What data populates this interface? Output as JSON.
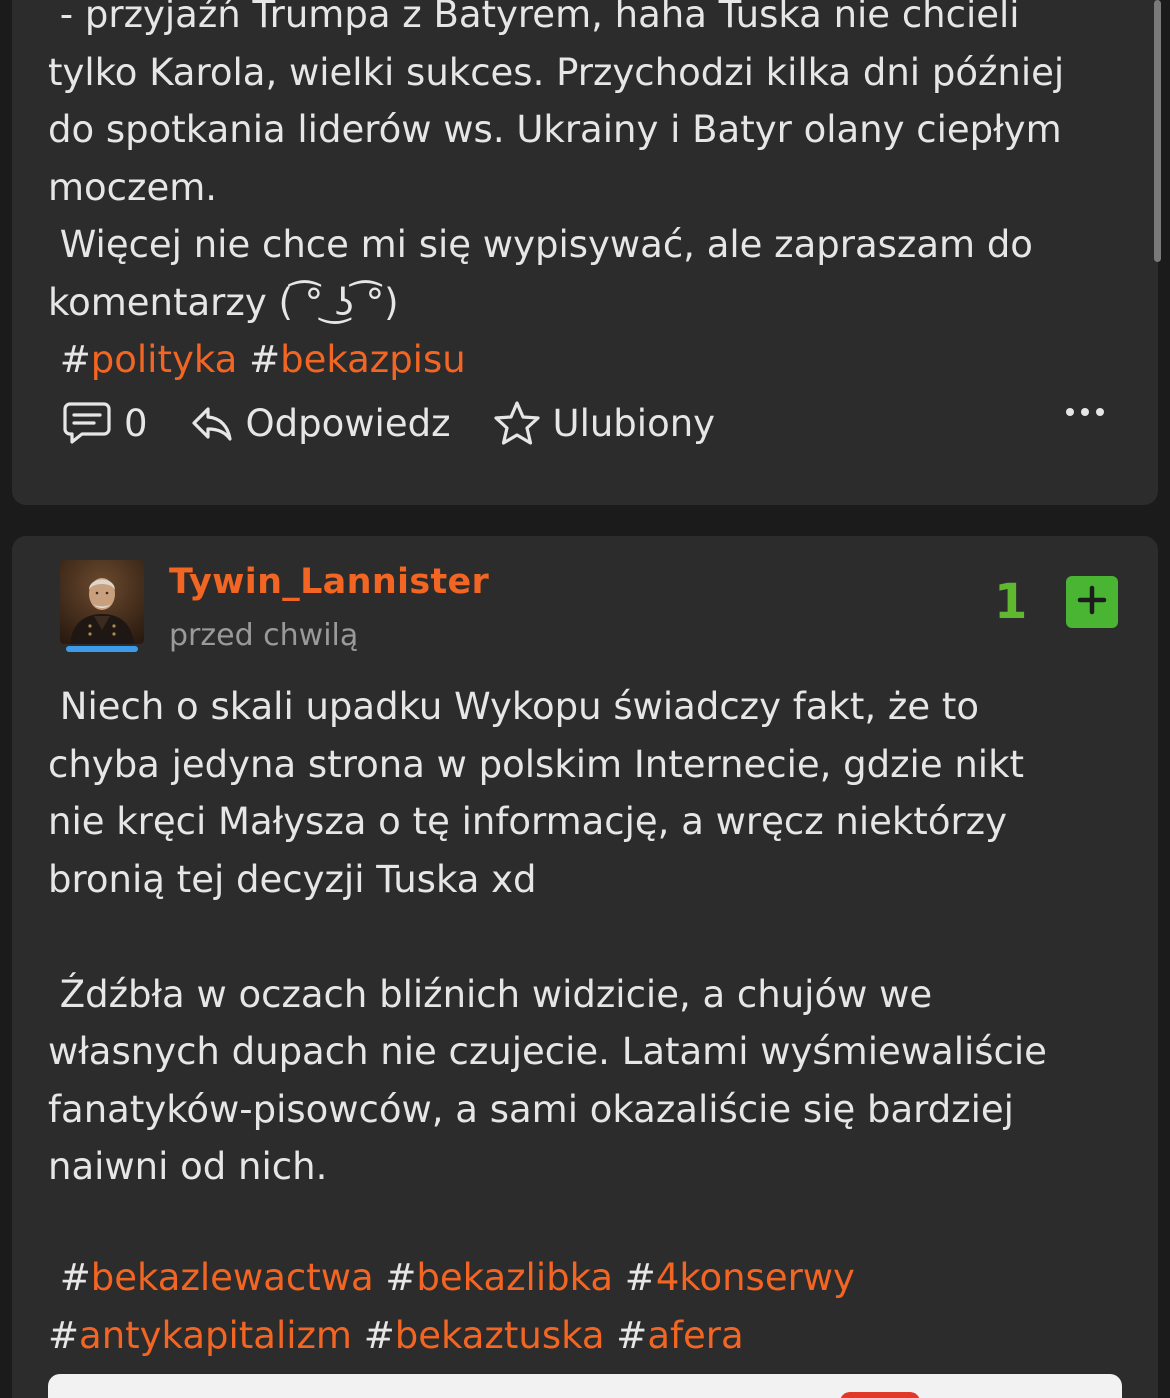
{
  "top_post": {
    "body": " - przyjaźń Trumpa z Batyrem, haha Tuska nie chcieli\ntylko Karola, wielki sukces. Przychodzi kilka dni później\ndo spotkania liderów ws. Ukrainy i Batyr olany ciepłym\nmoczem.\n Więcej nie chce mi się wypisywać, ale zapraszam do\nkomentarzy ( ͡° ͜ʖ ͡°)",
    "tags": [
      "polityka",
      "bekazpisu"
    ],
    "actions": {
      "comment_count": "0",
      "reply_label": "Odpowiedz",
      "favorite_label": "Ulubiony"
    }
  },
  "entry": {
    "username": "Tywin_Lannister",
    "timestamp": "przed chwilą",
    "votes": "1",
    "plus_label": "+",
    "body": " Niech o skali upadku Wykopu świadczy fakt, że to\nchyba jedyna strona w polskim Internecie, gdzie nikt\nnie kręci Małysza o tę informację, a wręcz niektórzy\nbronią tej decyzji Tuska xd\n\n Źdźbła w oczach bliźnich widzicie, a chujów we\nwłasnych dupach nie czujecie. Latami wyśmiewaliście\nfanatyków-pisowców, a sami okazaliście się bardziej\nnaiwni od nich.",
    "tags_line1": [
      "bekazlewactwa",
      "bekazlibka",
      "4konserwy"
    ],
    "tags_line2": [
      "antykapitalizm",
      "bekaztuska",
      "afera"
    ]
  },
  "colors": {
    "background": "#1b1b1b",
    "card": "#2c2c2c",
    "accent_orange": "#f26522",
    "vote_green": "#5fb830",
    "plus_green": "#4ab533",
    "avatar_bar_blue": "#3d9be9"
  },
  "icons": {
    "comment": "comment-icon",
    "reply": "reply-icon",
    "favorite": "star-icon",
    "more": "more-icon",
    "plus": "plus-icon"
  }
}
